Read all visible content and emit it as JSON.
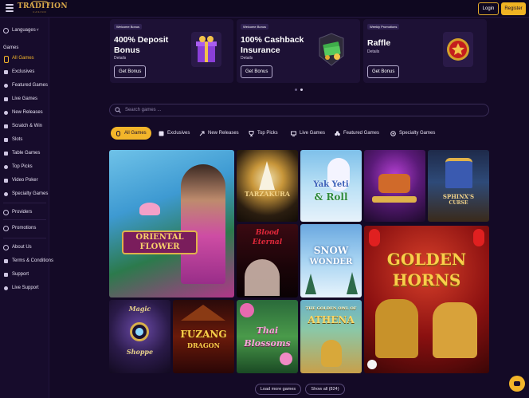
{
  "header": {
    "logo_text": "TRADITION",
    "logo_sub": "CASINO",
    "login_label": "Login",
    "register_label": "Register"
  },
  "sidebar": {
    "languages_label": "Languages",
    "games_heading": "Games",
    "items": [
      {
        "label": "All Games",
        "icon": "all-games-icon",
        "active": true
      },
      {
        "label": "Exclusives",
        "icon": "exclusives-icon"
      },
      {
        "label": "Featured Games",
        "icon": "featured-games-icon"
      },
      {
        "label": "Live Games",
        "icon": "live-games-icon"
      },
      {
        "label": "New Releases",
        "icon": "new-releases-icon"
      },
      {
        "label": "Scratch & Win",
        "icon": "scratch-win-icon"
      },
      {
        "label": "Slots",
        "icon": "slots-icon"
      },
      {
        "label": "Table Games",
        "icon": "table-games-icon"
      },
      {
        "label": "Top Picks",
        "icon": "top-picks-icon"
      },
      {
        "label": "Video Poker",
        "icon": "video-poker-icon"
      },
      {
        "label": "Specialty Games",
        "icon": "specialty-games-icon"
      }
    ],
    "providers_label": "Providers",
    "promotions_label": "Promotions",
    "about_label": "About Us",
    "terms_label": "Terms & Conditions",
    "support_label": "Support",
    "live_support_label": "Live Support"
  },
  "promos": [
    {
      "tag": "Welcome Bonus",
      "title": "400% Deposit Bonus",
      "details": "Details",
      "button": "Get Bonus",
      "art": "gift-box-icon"
    },
    {
      "tag": "Welcome Bonus",
      "title": "100% Cashback Insurance",
      "details": "Details",
      "button": "Get Bonus",
      "art": "cash-stack-icon"
    },
    {
      "tag": "Weekly Promotions",
      "title": "Raffle",
      "details": "Details",
      "button": "Get Bonus",
      "art": "star-medal-icon"
    }
  ],
  "search": {
    "placeholder": "Search games ..."
  },
  "tabs": [
    {
      "label": "All Games",
      "icon": "all-games-icon",
      "active": true
    },
    {
      "label": "Exclusives",
      "icon": "exclusives-icon"
    },
    {
      "label": "New Releases",
      "icon": "new-releases-icon"
    },
    {
      "label": "Top Picks",
      "icon": "top-picks-icon"
    },
    {
      "label": "Live Games",
      "icon": "live-games-icon"
    },
    {
      "label": "Featured Games",
      "icon": "featured-games-icon"
    },
    {
      "label": "Specialty Games",
      "icon": "specialty-games-icon"
    }
  ],
  "games": [
    {
      "title_l1": "ORIENTAL",
      "title_l2": "FLOWER"
    },
    {
      "title_l1": "TARZAKURA",
      "title_l2": ""
    },
    {
      "title_l1": "Yak Yeti",
      "title_l2": "& Roll"
    },
    {
      "title_l1": "",
      "title_l2": ""
    },
    {
      "title_l1": "SPHINX'S",
      "title_l2": "CURSE"
    },
    {
      "title_l1": "Blood",
      "title_l2": "Eternal"
    },
    {
      "title_l1": "SNOW",
      "title_l2": "WONDER"
    },
    {
      "title_l1": "GOLDEN",
      "title_l2": "HORNS"
    },
    {
      "title_l1": "Magic",
      "title_l2": "Shoppe"
    },
    {
      "title_l1": "FUZANG",
      "title_l2": "DRAGON"
    },
    {
      "title_l1": "Thai",
      "title_l2": "Blossoms"
    },
    {
      "title_l1": "THE GOLDEN OWL OF",
      "title_l2": "ATHENA"
    }
  ],
  "footer": {
    "load_more_label": "Load more games",
    "show_all_label": "Show all (824)"
  },
  "colors": {
    "background": "#140a26",
    "accent": "#f3b52a",
    "card": "#1d1135"
  }
}
